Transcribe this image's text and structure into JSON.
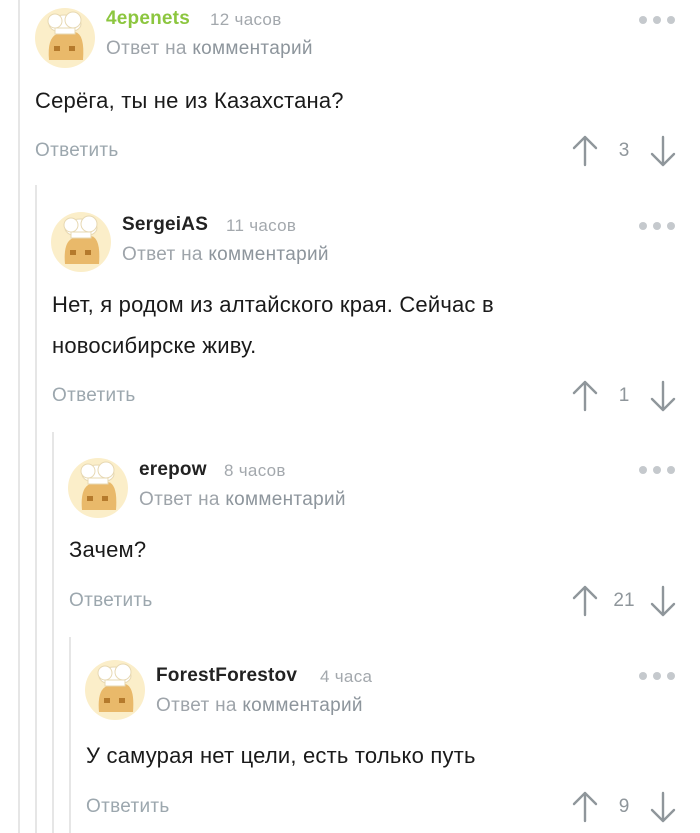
{
  "comments": [
    {
      "author": "4epenets",
      "author_color": "#8cc63f",
      "time": "12 часов",
      "reply_prefix": "Ответ на",
      "reply_link": "комментарий",
      "text": "Серёга, ты не из Казахстана?",
      "reply_label": "Ответить",
      "score": "3"
    },
    {
      "author": "SergeiAS",
      "author_color": "#222222",
      "time": "11 часов",
      "reply_prefix": "Ответ на",
      "reply_link": "комментарий",
      "text": "Нет, я родом из алтайского края. Сейчас в новосибирске живу.",
      "reply_label": "Ответить",
      "score": "1"
    },
    {
      "author": "erepow",
      "author_color": "#222222",
      "time": "8 часов",
      "reply_prefix": "Ответ на",
      "reply_link": "комментарий",
      "text": "Зачем?",
      "reply_label": "Ответить",
      "score": "21"
    },
    {
      "author": "ForestForestov",
      "author_color": "#222222",
      "time": "4 часа",
      "reply_prefix": "Ответ на",
      "reply_link": "комментарий",
      "text": "У самурая нет цели, есть только путь",
      "reply_label": "Ответить",
      "score": "9"
    }
  ],
  "icons": {
    "avatar": "default-chef-avatar-icon",
    "more": "more-dots-icon",
    "upvote": "arrow-up-icon",
    "downvote": "arrow-down-icon"
  }
}
